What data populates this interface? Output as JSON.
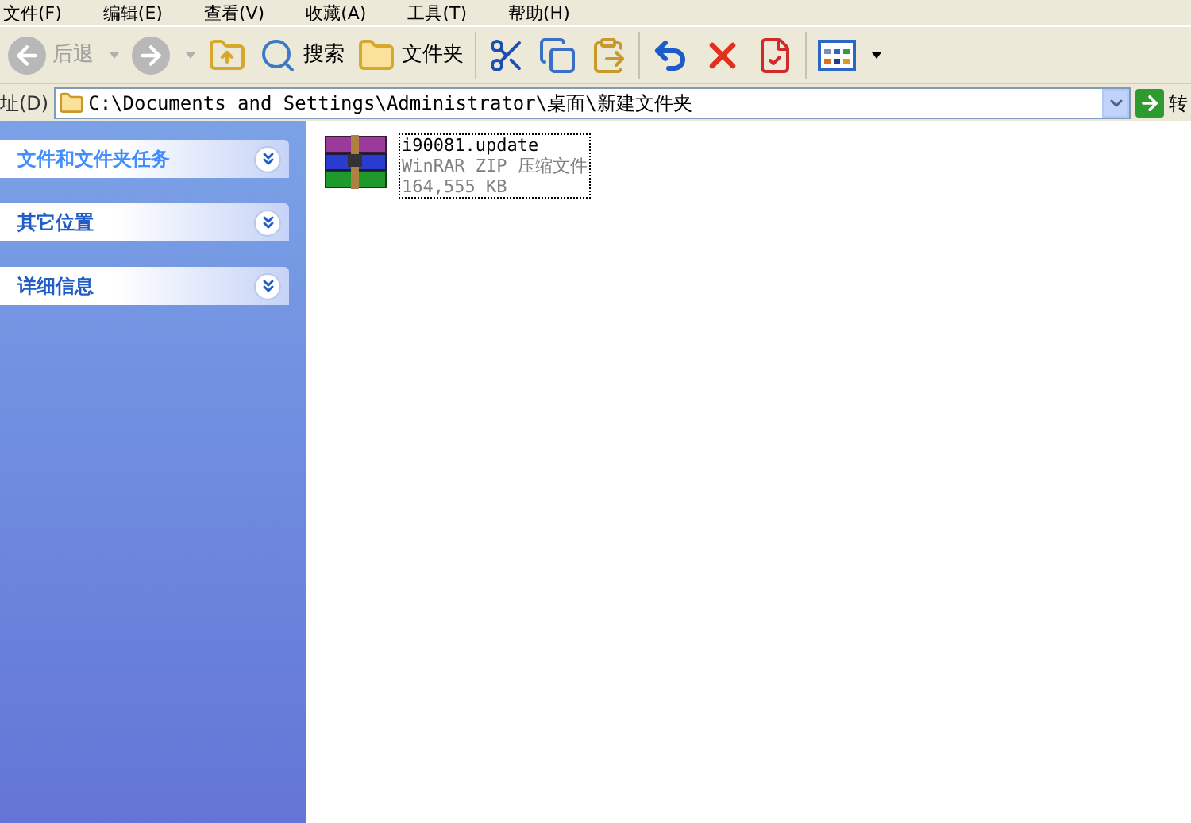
{
  "menu": [
    "文件(F)",
    "编辑(E)",
    "查看(V)",
    "收藏(A)",
    "工具(T)",
    "帮助(H)"
  ],
  "toolbar": [
    {
      "kind": "back",
      "label": "后退",
      "disabled": true
    },
    {
      "kind": "forward",
      "disabled": true
    },
    {
      "kind": "up",
      "disabled": false
    },
    {
      "kind": "search",
      "label": "搜索",
      "disabled": false
    },
    {
      "kind": "folders",
      "label": "文件夹",
      "disabled": false
    },
    {
      "kind": "separator"
    },
    {
      "kind": "cut",
      "disabled": false
    },
    {
      "kind": "copy",
      "disabled": false
    },
    {
      "kind": "paste",
      "disabled": false
    },
    {
      "kind": "separator"
    },
    {
      "kind": "undo",
      "disabled": false
    },
    {
      "kind": "delete",
      "disabled": false
    },
    {
      "kind": "properties",
      "disabled": false
    },
    {
      "kind": "separator"
    },
    {
      "kind": "views",
      "disabled": false
    }
  ],
  "address_bar": {
    "label": "址(D)",
    "value": "C:\\Documents and Settings\\Administrator\\桌面\\新建文件夹",
    "go_label": "转"
  },
  "sidebar": {
    "panels": [
      {
        "title": "文件和文件夹任务",
        "highlighted": true,
        "expanded": false
      },
      {
        "title": "其它位置",
        "highlighted": false,
        "expanded": false
      },
      {
        "title": "详细信息",
        "highlighted": false,
        "expanded": false
      }
    ]
  },
  "files": [
    {
      "name": "i90081.update",
      "type": "WinRAR ZIP 压缩文件",
      "size": "164,555 KB",
      "selected": true
    }
  ]
}
